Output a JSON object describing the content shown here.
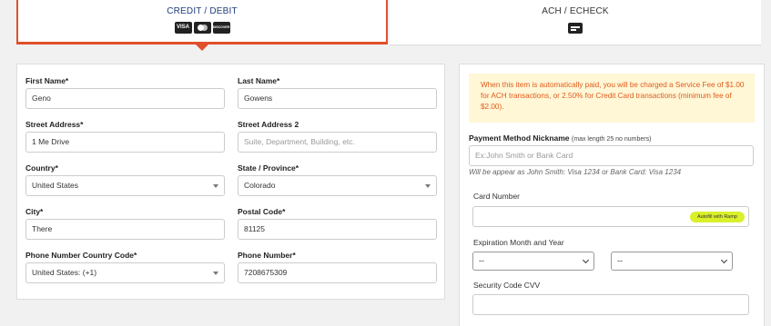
{
  "tabs": {
    "credit": {
      "label": "CREDIT / DEBIT",
      "icons": [
        "visa-icon",
        "mastercard-icon",
        "discover-icon"
      ],
      "brand_texts": [
        "VISA",
        "DISCOVER"
      ]
    },
    "ach": {
      "label": "ACH / ECHECK",
      "icon": "echeck-icon"
    }
  },
  "colors": {
    "accent": "#e0502b",
    "active_tab_text": "#1f3d7a",
    "notice_bg": "#fff7d6",
    "notice_text": "#e25a1c",
    "autofill_bg": "#d9f02a"
  },
  "billing": {
    "first_name": {
      "label": "First Name*",
      "value": "Geno"
    },
    "last_name": {
      "label": "Last Name*",
      "value": "Gowens"
    },
    "street1": {
      "label": "Street Address*",
      "value": "1 Me Drive"
    },
    "street2": {
      "label": "Street Address 2",
      "placeholder": "Suite, Department, Building, etc."
    },
    "country": {
      "label": "Country*",
      "value": "United States"
    },
    "state": {
      "label": "State / Province*",
      "value": "Colorado"
    },
    "city": {
      "label": "City*",
      "value": "There"
    },
    "postal": {
      "label": "Postal Code*",
      "value": "81125"
    },
    "phone_country": {
      "label": "Phone Number Country Code*",
      "value": "United States: (+1)"
    },
    "phone": {
      "label": "Phone Number*",
      "value": "7208675309"
    }
  },
  "payment": {
    "notice": "When this item is automatically paid, you will be charged a Service Fee of $1.00 for ACH transactions, or 2.50% for Credit Card transactions (minimum fee of $2.00).",
    "nickname": {
      "label": "Payment Method Nickname",
      "sublabel": "(max length 25 no numbers)",
      "placeholder": "Ex:John Smith or Bank Card",
      "hint": "Will be appear as John Smith: Visa 1234 or Bank Card: Visa 1234"
    },
    "card_number": {
      "label": "Card Number",
      "autofill": "Autofill with Ramp"
    },
    "expiration": {
      "label": "Expiration Month and Year",
      "month": "--",
      "year": "--"
    },
    "cvv": {
      "label": "Security Code CVV"
    }
  }
}
